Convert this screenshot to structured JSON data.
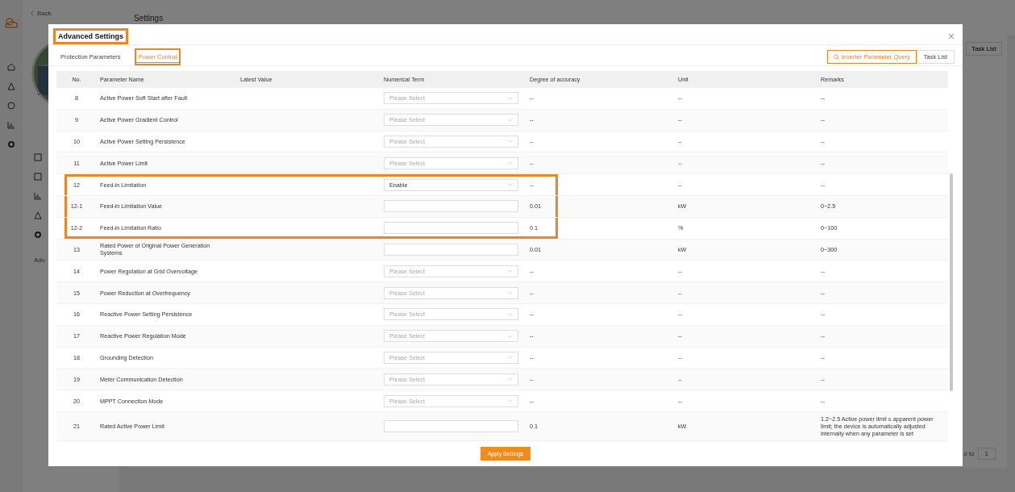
{
  "background": {
    "back_link": "Back",
    "page_title": "Settings",
    "section_label": "Adv",
    "task_list_button": "Task List",
    "pagination": {
      "goto_label": "o to",
      "page": "1"
    }
  },
  "dialog": {
    "title": "Advanced Settings",
    "title_highlighted": true,
    "tabs": [
      {
        "label": "Protection Parameters",
        "selected": false,
        "highlighted": false
      },
      {
        "label": "Power Control",
        "selected": true,
        "highlighted": true
      }
    ],
    "query_button": "Inverter Parameter Query",
    "task_list_button": "Task List",
    "table": {
      "columns": [
        "No.",
        "Parameter Name",
        "Latest Value",
        "Numerical Term",
        "Degree of accuracy",
        "Unit",
        "Remarks"
      ],
      "rows": [
        {
          "no": "8",
          "name": "Active Power Soft Start after Fault",
          "kind": "select",
          "placeholder": "Please Select",
          "accuracy": "--",
          "unit": "--",
          "remarks": "--",
          "highlighted": false
        },
        {
          "no": "9",
          "name": "Active Power Gradient Control",
          "kind": "select",
          "placeholder": "Please Select",
          "accuracy": "--",
          "unit": "--",
          "remarks": "--",
          "highlighted": false
        },
        {
          "no": "10",
          "name": "Active Power Setting Persistence",
          "kind": "select",
          "placeholder": "Please Select",
          "accuracy": "--",
          "unit": "--",
          "remarks": "--",
          "highlighted": false
        },
        {
          "no": "11",
          "name": "Active Power Limit",
          "kind": "select",
          "placeholder": "Please Select",
          "accuracy": "--",
          "unit": "--",
          "remarks": "--",
          "highlighted": false
        },
        {
          "no": "12",
          "name": "Feed-in Limitation",
          "kind": "select",
          "value": "Enable",
          "accuracy": "--",
          "unit": "--",
          "remarks": "--",
          "highlighted": true
        },
        {
          "no": "12-1",
          "name": "Feed-in Limitation Value",
          "kind": "input",
          "accuracy": "0.01",
          "unit": "kW",
          "remarks": "0~2.5",
          "highlighted": true
        },
        {
          "no": "12-2",
          "name": "Feed-in Limitation Ratio",
          "kind": "input",
          "accuracy": "0.1",
          "unit": "%",
          "remarks": "0~100",
          "highlighted": true
        },
        {
          "no": "13",
          "name": "Rated Power of Original Power Generation Systems",
          "kind": "input",
          "accuracy": "0.01",
          "unit": "kW",
          "remarks": "0~300",
          "highlighted": false
        },
        {
          "no": "14",
          "name": "Power Regulation at Grid Overvoltage",
          "kind": "select",
          "placeholder": "Please Select",
          "accuracy": "--",
          "unit": "--",
          "remarks": "--",
          "highlighted": false
        },
        {
          "no": "15",
          "name": "Power Reduction at Overfrequency",
          "kind": "select",
          "placeholder": "Please Select",
          "accuracy": "--",
          "unit": "--",
          "remarks": "--",
          "highlighted": false
        },
        {
          "no": "16",
          "name": "Reactive Power Setting Persistence",
          "kind": "select",
          "placeholder": "Please Select",
          "accuracy": "--",
          "unit": "--",
          "remarks": "--",
          "highlighted": false
        },
        {
          "no": "17",
          "name": "Reactive Power Regulation Mode",
          "kind": "select",
          "placeholder": "Please Select",
          "accuracy": "--",
          "unit": "--",
          "remarks": "--",
          "highlighted": false
        },
        {
          "no": "18",
          "name": "Grounding Detection",
          "kind": "select",
          "placeholder": "Please Select",
          "accuracy": "--",
          "unit": "--",
          "remarks": "--",
          "highlighted": false
        },
        {
          "no": "19",
          "name": "Meter Communication Detection",
          "kind": "select",
          "placeholder": "Please Select",
          "accuracy": "--",
          "unit": "--",
          "remarks": "--",
          "highlighted": false
        },
        {
          "no": "20",
          "name": "MPPT Connection Mode",
          "kind": "select",
          "placeholder": "Please Select",
          "accuracy": "--",
          "unit": "--",
          "remarks": "--",
          "highlighted": false
        },
        {
          "no": "21",
          "name": "Rated Active Power Limit",
          "kind": "input",
          "accuracy": "0.1",
          "unit": "kW",
          "remarks": "1.2~2.5 Active power limit ≤ apparent power limit; the device is automatically adjusted internally when any parameter is set",
          "highlighted": false
        }
      ]
    },
    "apply_button": "Apply Settings"
  }
}
